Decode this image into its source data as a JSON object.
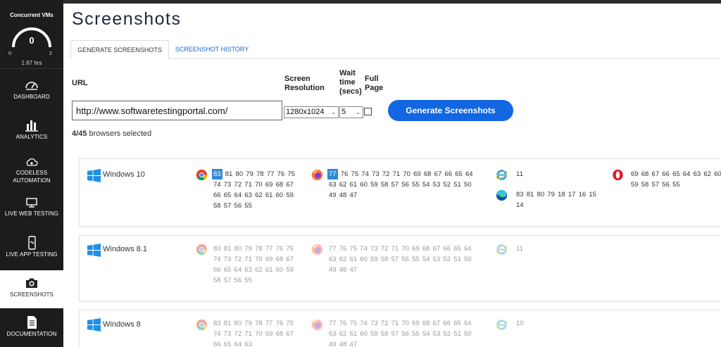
{
  "sidebar": {
    "vm": {
      "title": "Concurrent VMs",
      "value": "0",
      "min": "0",
      "max": "2",
      "hours": "1.67 hrs"
    },
    "items": [
      {
        "label": "DASHBOARD",
        "icon": "speedometer-icon"
      },
      {
        "label": "ANALYTICS",
        "icon": "bar-chart-icon"
      },
      {
        "label": "CODELESS AUTOMATION",
        "icon": "cloud-gear-icon"
      },
      {
        "label": "LIVE WEB TESTING",
        "icon": "monitor-icon"
      },
      {
        "label": "LIVE APP TESTING",
        "icon": "mobile-icon"
      },
      {
        "label": "SCREENSHOTS",
        "icon": "camera-icon"
      },
      {
        "label": "DOCUMENTATION",
        "icon": "document-icon"
      }
    ]
  },
  "page": {
    "title": "Screenshots"
  },
  "tabs": {
    "generate": "GENERATE SCREENSHOTS",
    "history": "SCREENSHOT HISTORY"
  },
  "form": {
    "url_label": "URL",
    "url_value": "http://www.softwaretestingportal.com/",
    "resolution_label_1": "Screen",
    "resolution_label_2": "Resolution",
    "resolution_value": "1280x1024",
    "wait_label_1": "Wait",
    "wait_label_2": "time",
    "wait_label_3": "(secs)",
    "wait_value": "5",
    "fullpage_label_1": "Full",
    "fullpage_label_2": "Page",
    "generate_button": "Generate Screenshots",
    "selected_count": "4/45",
    "selected_suffix": " browsers selected"
  },
  "os_list": [
    {
      "name": "Windows 10",
      "chrome": [
        "83",
        "81",
        "80",
        "79",
        "78",
        "77",
        "76",
        "75",
        "74",
        "73",
        "72",
        "71",
        "70",
        "69",
        "68",
        "67",
        "66",
        "65",
        "64",
        "63",
        "62",
        "61",
        "60",
        "59",
        "58",
        "57",
        "56",
        "55"
      ],
      "firefox": [
        "77",
        "76",
        "75",
        "74",
        "73",
        "72",
        "71",
        "70",
        "69",
        "68",
        "67",
        "66",
        "65",
        "64",
        "63",
        "62",
        "61",
        "60",
        "59",
        "58",
        "57",
        "56",
        "55",
        "54",
        "53",
        "52",
        "51",
        "50",
        "49",
        "48",
        "47"
      ],
      "ie": [
        "11"
      ],
      "edge": [
        "83",
        "81",
        "80",
        "79",
        "18",
        "17",
        "16",
        "15",
        "14"
      ],
      "opera": [
        "69",
        "68",
        "67",
        "66",
        "65",
        "64",
        "63",
        "62",
        "60",
        "59",
        "58",
        "57",
        "56",
        "55"
      ]
    },
    {
      "name": "Windows 8.1",
      "chrome": [
        "83",
        "81",
        "80",
        "79",
        "78",
        "77",
        "76",
        "75",
        "74",
        "73",
        "72",
        "71",
        "70",
        "69",
        "68",
        "67",
        "66",
        "65",
        "64",
        "63",
        "62",
        "61",
        "60",
        "59",
        "58",
        "57",
        "56",
        "55"
      ],
      "firefox": [
        "77",
        "76",
        "75",
        "74",
        "73",
        "72",
        "71",
        "70",
        "69",
        "68",
        "67",
        "66",
        "65",
        "64",
        "63",
        "62",
        "61",
        "60",
        "59",
        "58",
        "57",
        "56",
        "55",
        "54",
        "53",
        "52",
        "51",
        "50",
        "49",
        "48",
        "47"
      ],
      "ie": [
        "11"
      ]
    },
    {
      "name": "Windows 8",
      "chrome": [
        "83",
        "81",
        "80",
        "79",
        "78",
        "77",
        "76",
        "75",
        "74",
        "73",
        "72",
        "71",
        "70",
        "69",
        "68",
        "67",
        "66",
        "65",
        "64",
        "63"
      ],
      "firefox": [
        "77",
        "76",
        "75",
        "74",
        "73",
        "72",
        "71",
        "70",
        "69",
        "68",
        "67",
        "66",
        "65",
        "64",
        "63",
        "62",
        "61",
        "60",
        "59",
        "58",
        "57",
        "56",
        "55",
        "54",
        "53",
        "52",
        "51",
        "50",
        "49",
        "48",
        "47"
      ],
      "ie": [
        "10"
      ]
    }
  ],
  "colors": {
    "accent": "#1266e2",
    "sidebar": "#1c1c1c",
    "selected_version": "#2f8ad6"
  }
}
